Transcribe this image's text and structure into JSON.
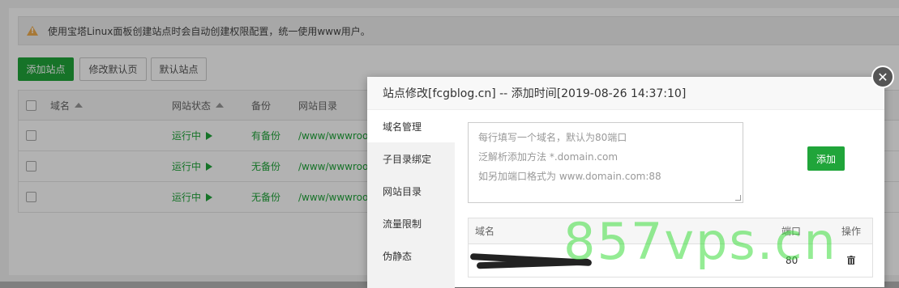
{
  "notice": {
    "text": "使用宝塔Linux面板创建站点时会自动创建权限配置，统一使用www用户。"
  },
  "toolbar": {
    "add_site": "添加站点",
    "edit_default_page": "修改默认页",
    "default_site": "默认站点"
  },
  "site_table": {
    "headers": [
      "域名",
      "网站状态",
      "备份",
      "网站目录"
    ],
    "rows": [
      {
        "status": "运行中",
        "backup": "有备份",
        "dir": "/www/wwwroo"
      },
      {
        "status": "运行中",
        "backup": "无备份",
        "dir": "/www/wwwroo"
      },
      {
        "status": "运行中",
        "backup": "无备份",
        "dir": "/www/wwwroo"
      }
    ]
  },
  "modal": {
    "title": "站点修改[fcgblog.cn] -- 添加时间[2019-08-26 14:37:10]",
    "tabs": [
      "域名管理",
      "子目录绑定",
      "网站目录",
      "流量限制",
      "伪静态"
    ],
    "placeholder_lines": [
      "每行填写一个域名，默认为80端口",
      "泛解析添加方法 *.domain.com",
      "如另加端口格式为 www.domain.com:88"
    ],
    "add_label": "添加",
    "domain_table": {
      "headers": [
        "域名",
        "端口",
        "操作"
      ],
      "rows": [
        {
          "port": "80"
        }
      ]
    }
  },
  "watermark": "857vps.cn",
  "colors": {
    "accent": "#20a53a",
    "warning": "#f0ad4e"
  }
}
